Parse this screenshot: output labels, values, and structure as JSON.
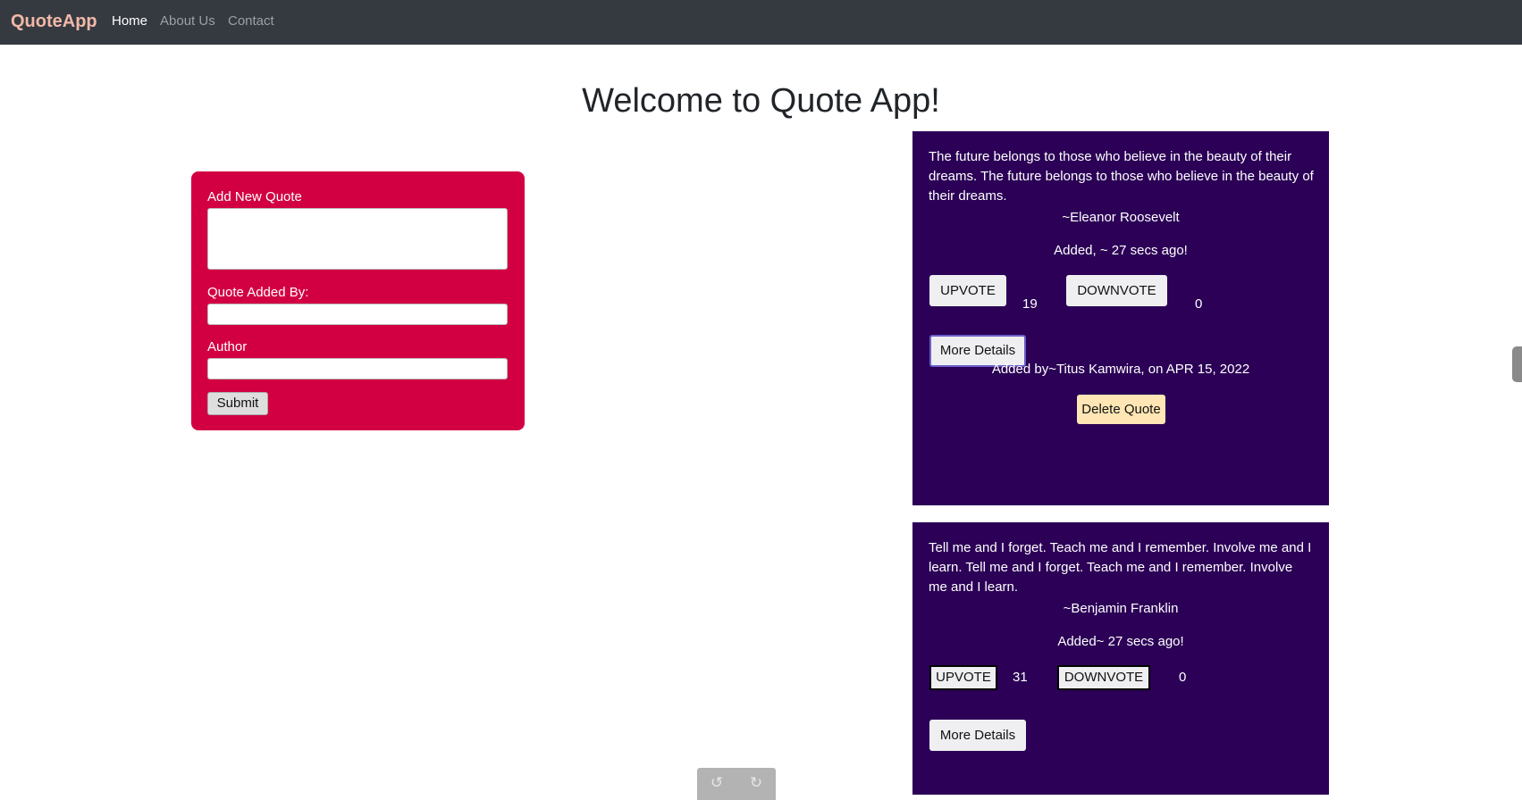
{
  "navbar": {
    "brand": "QuoteApp",
    "links": [
      "Home",
      "About Us",
      "Contact"
    ],
    "brand_color": "#f2b8a8",
    "background": "#343a40"
  },
  "page": {
    "title": "Welcome to Quote App!"
  },
  "form": {
    "label_new_quote": "Add New Quote",
    "label_added_by": "Quote Added By:",
    "label_author": "Author",
    "new_quote_value": "",
    "added_by_value": "",
    "author_value": "",
    "submit_label": "Submit",
    "card_color": "#d20043"
  },
  "quotes": [
    {
      "text": "The future belongs to those who believe in the beauty of their dreams. The future belongs to those who believe in the beauty of their dreams.",
      "author": "~Eleanor Roosevelt",
      "added_time": "Added, ~ 27 secs ago!",
      "upvote_label": "UPVOTE",
      "upvotes": "19",
      "downvote_label": "DOWNVOTE",
      "downvotes": "0",
      "more_details_label": "More Details",
      "added_by": "Added by~Titus Kamwira, on APR 15, 2022",
      "delete_label": "Delete Quote"
    },
    {
      "text": "Tell me and I forget. Teach me and I remember. Involve me and I learn. Tell me and I forget. Teach me and I remember. Involve me and I learn.",
      "author": "~Benjamin Franklin",
      "added_time": "Added~ 27 secs ago!",
      "upvote_label": "UPVOTE",
      "upvotes": "31",
      "downvote_label": "DOWNVOTE",
      "downvotes": "0",
      "more_details_label": "More Details"
    }
  ],
  "quote_card_color": "#2b0056",
  "toolbar": {
    "icons": [
      "undo-icon",
      "redo-icon"
    ]
  }
}
